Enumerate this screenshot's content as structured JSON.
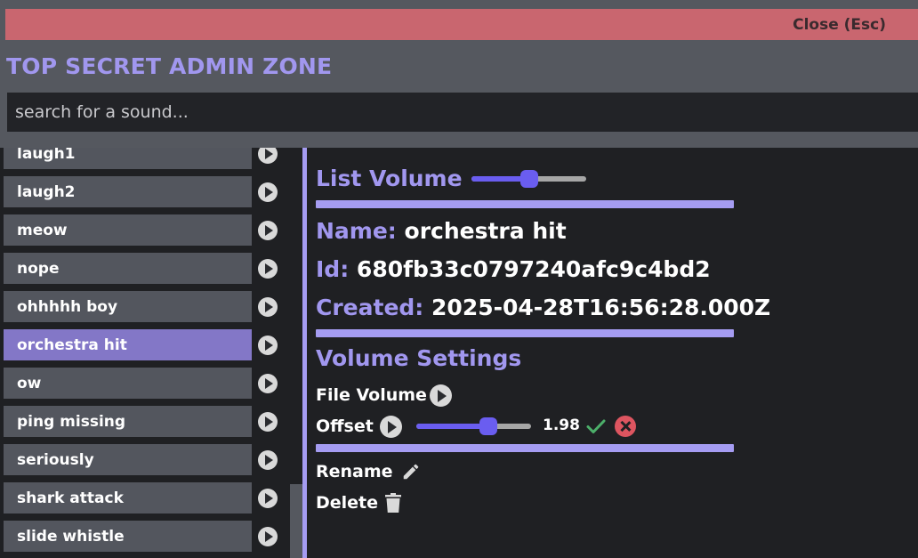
{
  "header": {
    "close_label": "Close (Esc)",
    "title": "TOP SECRET ADMIN ZONE"
  },
  "search": {
    "placeholder": "search for a sound..."
  },
  "sounds": [
    {
      "label": "laugh1",
      "selected": false
    },
    {
      "label": "laugh2",
      "selected": false
    },
    {
      "label": "meow",
      "selected": false
    },
    {
      "label": "nope",
      "selected": false
    },
    {
      "label": "ohhhhh boy",
      "selected": false
    },
    {
      "label": "orchestra hit",
      "selected": true
    },
    {
      "label": "ow",
      "selected": false
    },
    {
      "label": "ping missing",
      "selected": false
    },
    {
      "label": "seriously",
      "selected": false
    },
    {
      "label": "shark attack",
      "selected": false
    },
    {
      "label": "slide whistle",
      "selected": false
    }
  ],
  "detail": {
    "list_volume_label": "List Volume",
    "list_volume_level": 0.5,
    "name_label": "Name:",
    "name_value": "orchestra hit",
    "id_label": "Id:",
    "id_value": "680fb33c0797240afc9c4bd2",
    "created_label": "Created:",
    "created_value": "2025-04-28T16:56:28.000Z",
    "volume_settings_title": "Volume Settings",
    "file_volume_label": "File Volume",
    "offset_label": "Offset",
    "offset_level": 0.63,
    "offset_value": "1.98",
    "rename_label": "Rename",
    "delete_label": "Delete"
  },
  "colors": {
    "accent": "#a197ef",
    "slider": "#6a5df0",
    "close_bar": "#c9666f",
    "selected_item": "#8377c7",
    "confirm": "#4caf6a",
    "cancel": "#dd5560"
  },
  "icons": {
    "play": "play-icon",
    "confirm": "check-icon",
    "cancel": "cancel-icon",
    "rename": "pencil-icon",
    "delete": "trash-icon"
  }
}
